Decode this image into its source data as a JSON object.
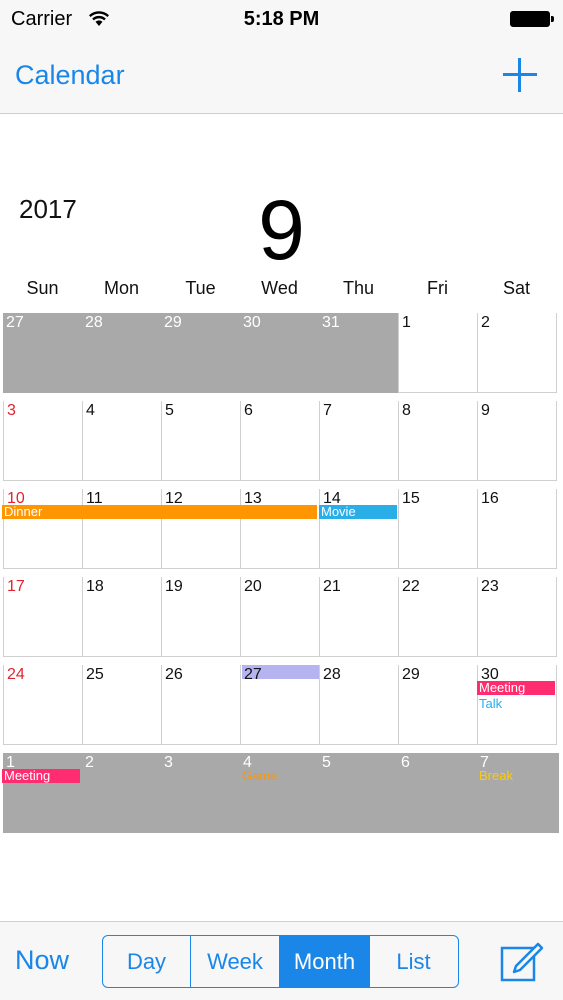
{
  "status_bar": {
    "carrier": "Carrier",
    "time": "5:18 PM"
  },
  "nav": {
    "title": "Calendar"
  },
  "header": {
    "year": "2017",
    "month": "9"
  },
  "weekdays": [
    "Sun",
    "Mon",
    "Tue",
    "Wed",
    "Thu",
    "Fri",
    "Sat"
  ],
  "weeks": [
    [
      {
        "d": "27",
        "out": true
      },
      {
        "d": "28",
        "out": true
      },
      {
        "d": "29",
        "out": true
      },
      {
        "d": "30",
        "out": true
      },
      {
        "d": "31",
        "out": true
      },
      {
        "d": "1"
      },
      {
        "d": "2"
      }
    ],
    [
      {
        "d": "3",
        "sun": true
      },
      {
        "d": "4"
      },
      {
        "d": "5"
      },
      {
        "d": "6"
      },
      {
        "d": "7"
      },
      {
        "d": "8"
      },
      {
        "d": "9"
      }
    ],
    [
      {
        "d": "10",
        "sun": true
      },
      {
        "d": "11"
      },
      {
        "d": "12"
      },
      {
        "d": "13"
      },
      {
        "d": "14"
      },
      {
        "d": "15"
      },
      {
        "d": "16"
      }
    ],
    [
      {
        "d": "17",
        "sun": true
      },
      {
        "d": "18"
      },
      {
        "d": "19"
      },
      {
        "d": "20"
      },
      {
        "d": "21"
      },
      {
        "d": "22"
      },
      {
        "d": "23"
      }
    ],
    [
      {
        "d": "24",
        "sun": true
      },
      {
        "d": "25"
      },
      {
        "d": "26"
      },
      {
        "d": "27",
        "today": true
      },
      {
        "d": "28"
      },
      {
        "d": "29"
      },
      {
        "d": "30"
      }
    ],
    [
      {
        "d": "1",
        "out": true
      },
      {
        "d": "2",
        "out": true
      },
      {
        "d": "3",
        "out": true
      },
      {
        "d": "4",
        "out": true
      },
      {
        "d": "5",
        "out": true
      },
      {
        "d": "6",
        "out": true
      },
      {
        "d": "7",
        "out": true
      }
    ]
  ],
  "events": [
    {
      "title": "Dinner",
      "week": 2,
      "start": 0,
      "span": 4,
      "color": "#ff9500",
      "style": "filled"
    },
    {
      "title": "Movie",
      "week": 2,
      "start": 4,
      "span": 1,
      "color": "#2aaee8",
      "style": "filled"
    },
    {
      "title": "Meeting",
      "week": 4,
      "start": 6,
      "span": 1,
      "color": "#ff2d6f",
      "style": "filled"
    },
    {
      "title": "Talk",
      "week": 4,
      "start": 6,
      "span": 1,
      "color": "#2aaee8",
      "style": "text"
    },
    {
      "title": "Meeting",
      "week": 5,
      "start": 0,
      "span": 1,
      "color": "#ff2d6f",
      "style": "filled"
    },
    {
      "title": "Game",
      "week": 5,
      "start": 3,
      "span": 1,
      "color": "#ff9500",
      "style": "text"
    },
    {
      "title": "Break",
      "week": 5,
      "start": 6,
      "span": 1,
      "color": "#ffcc00",
      "style": "text"
    }
  ],
  "today_highlight_color": "#b5b3f0",
  "tabbar": {
    "now_label": "Now",
    "segments": [
      {
        "label": "Day",
        "active": false
      },
      {
        "label": "Week",
        "active": false
      },
      {
        "label": "Month",
        "active": true
      },
      {
        "label": "List",
        "active": false
      }
    ]
  },
  "colors": {
    "accent": "#1a86e8",
    "sunday": "#e0242f",
    "out_of_month": "#a9a9a9"
  }
}
